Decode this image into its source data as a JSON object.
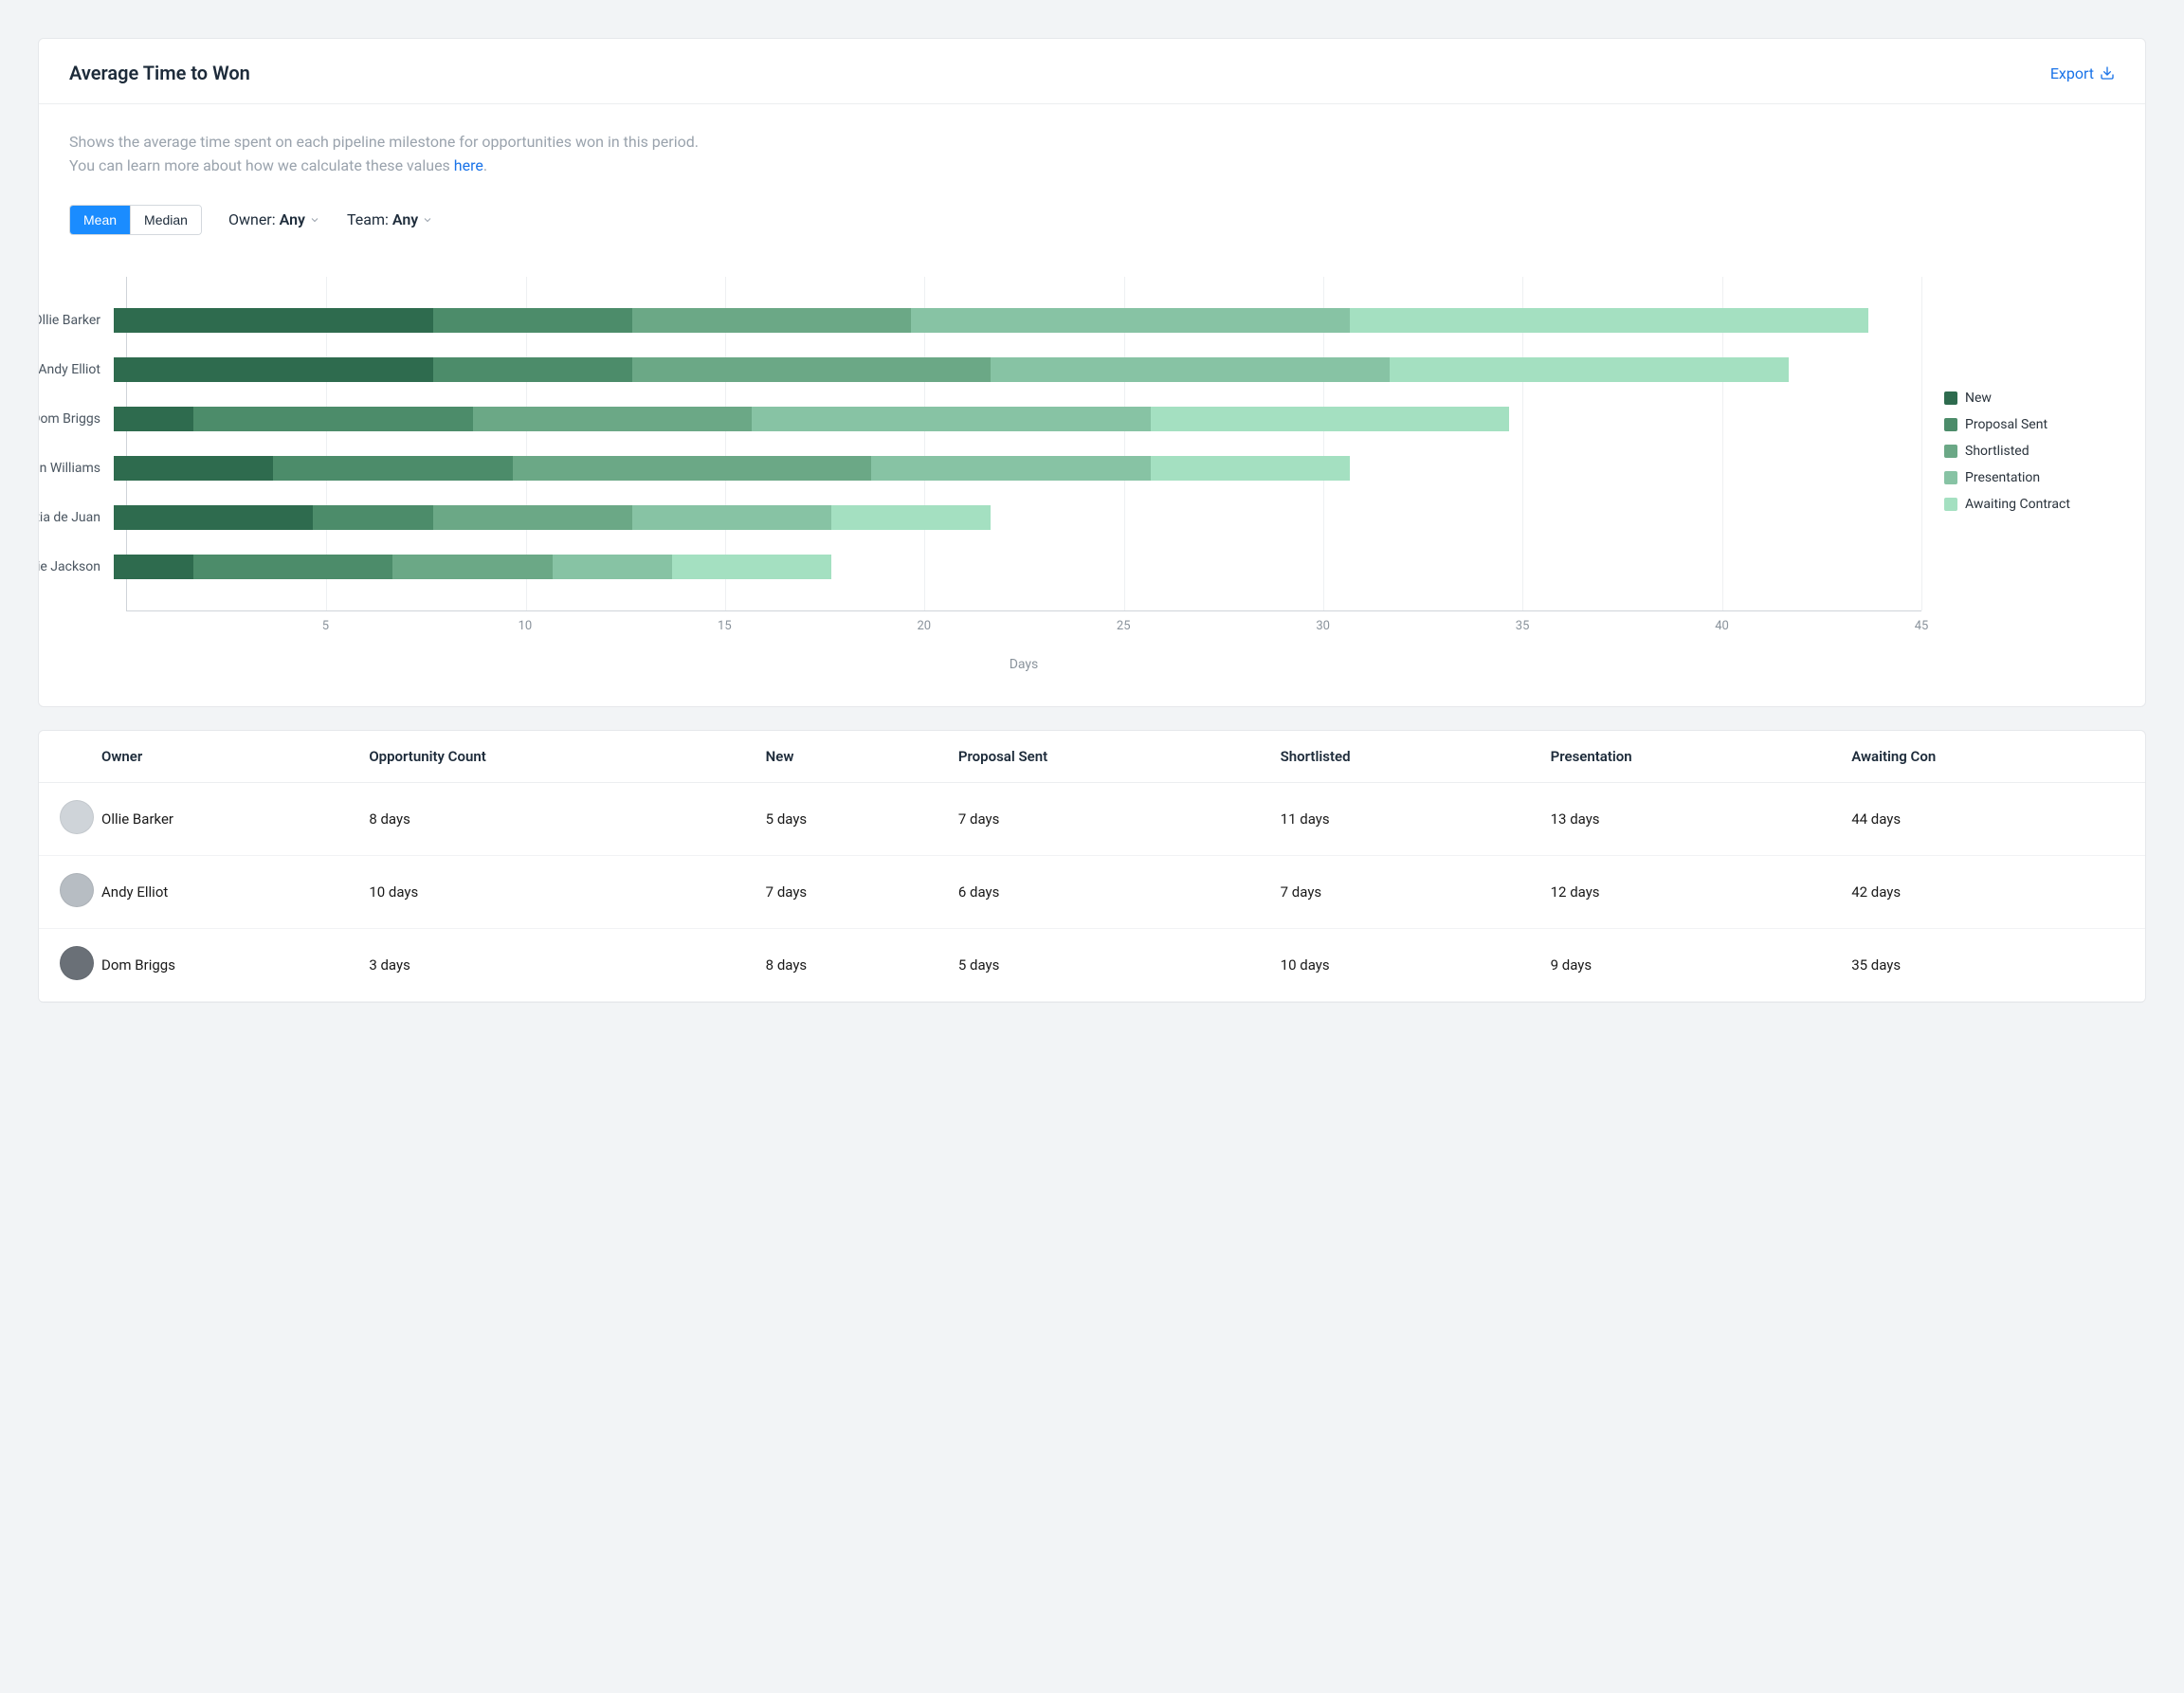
{
  "header": {
    "title": "Average Time to Won",
    "export_label": "Export"
  },
  "description": {
    "line1": "Shows the average time spent on each pipeline milestone for opportunities won in this period.",
    "line2_prefix": "You can learn more about how we calculate these values ",
    "link_text": "here",
    "line2_suffix": "."
  },
  "controls": {
    "mean_label": "Mean",
    "median_label": "Median",
    "owner_label": "Owner: ",
    "owner_value": "Any",
    "team_label": "Team: ",
    "team_value": "Any"
  },
  "chart_data": {
    "type": "bar",
    "orientation": "horizontal",
    "stacked": true,
    "xlabel": "Days",
    "xlim": [
      0,
      45
    ],
    "xticks": [
      5,
      10,
      15,
      20,
      25,
      30,
      35,
      40,
      45
    ],
    "categories": [
      "Ollie Barker",
      "Andy Elliot",
      "Dom Briggs",
      "Gavin Williams",
      "Katia de Juan",
      "Ollie Jackson"
    ],
    "series": [
      {
        "name": "New",
        "color": "#2e6b4e",
        "values": [
          8,
          8,
          2,
          4,
          5,
          2
        ]
      },
      {
        "name": "Proposal Sent",
        "color": "#4c8c6a",
        "values": [
          5,
          5,
          7,
          6,
          3,
          5
        ]
      },
      {
        "name": "Shortlisted",
        "color": "#6ba886",
        "values": [
          7,
          9,
          7,
          9,
          5,
          4
        ]
      },
      {
        "name": "Presentation",
        "color": "#87c3a4",
        "values": [
          11,
          10,
          10,
          7,
          5,
          3
        ]
      },
      {
        "name": "Awaiting Contract",
        "color": "#a4e0c1",
        "values": [
          13,
          10,
          9,
          5,
          4,
          4
        ]
      }
    ]
  },
  "table": {
    "headers": [
      "Owner",
      "Opportunity Count",
      "New",
      "Proposal Sent",
      "Shortlisted",
      "Presentation",
      "Awaiting Con"
    ],
    "rows": [
      {
        "avatar_color": "#cfd4d9",
        "owner": "Ollie Barker",
        "cells": [
          "8 days",
          "5 days",
          "7 days",
          "11 days",
          "13 days",
          "44 days"
        ]
      },
      {
        "avatar_color": "#b7bdc3",
        "owner": "Andy Elliot",
        "cells": [
          "10 days",
          "7 days",
          "6 days",
          "7 days",
          "12 days",
          "42 days"
        ]
      },
      {
        "avatar_color": "#6a7077",
        "owner": "Dom Briggs",
        "cells": [
          "3 days",
          "8 days",
          "5 days",
          "10 days",
          "9 days",
          "35 days"
        ]
      }
    ]
  }
}
